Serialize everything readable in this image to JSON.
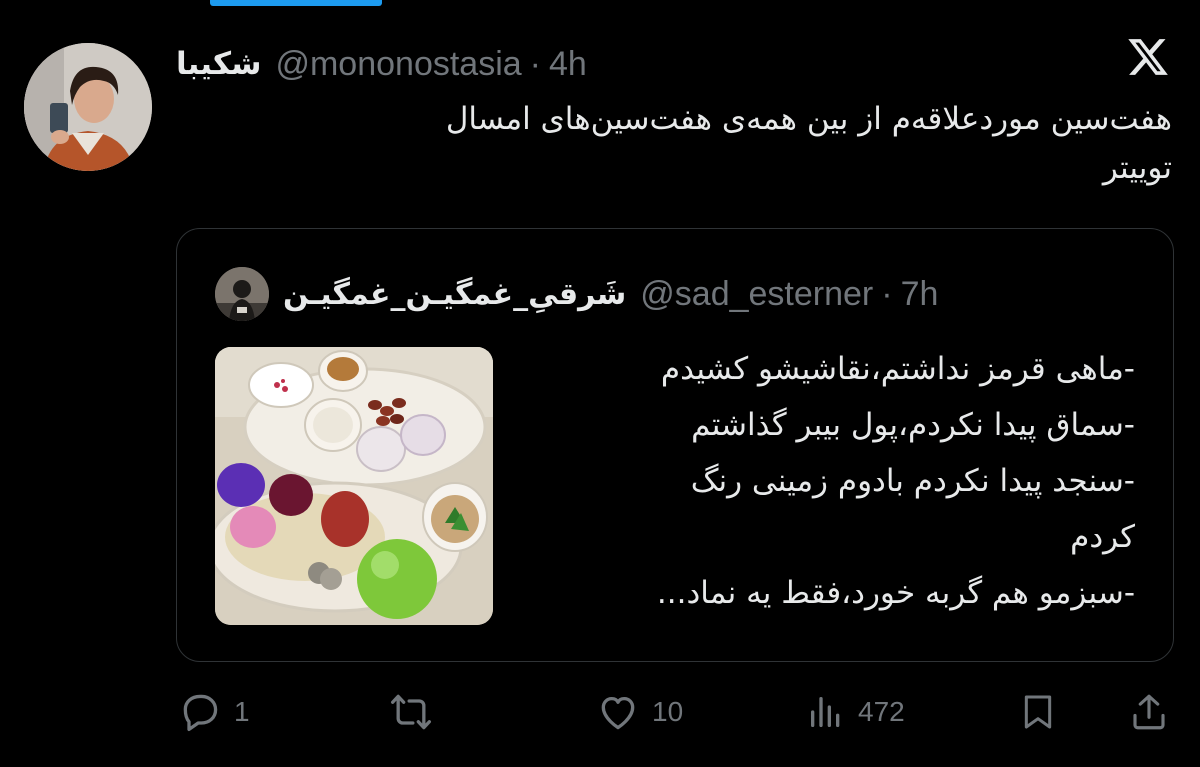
{
  "tweet": {
    "author": {
      "display_name": "شکیبا",
      "handle": "@mononostasia",
      "time": "4h"
    },
    "text": "هفت‌سین موردعلاقه‌م از بین همه‌ی هفت‌سین‌های امسال\nتوییتر",
    "quoted": {
      "author": {
        "display_name": "شَرقیِ_غمگیـن_غمگیـن",
        "handle": "@sad_esterner",
        "time": "7h"
      },
      "lines": [
        "-ماهی قرمز نداشتم،نقاشیشو کشیدم",
        "-سماق پیدا نکردم،پول بیبر گذاشتم",
        "-سنجد پیدا نکردم بادوم زمینی رنگ",
        "کردم",
        "-سبزمو هم گربه خورد،فقط یه نماد..."
      ]
    },
    "actions": {
      "replies": "1",
      "likes": "10",
      "views": "472"
    }
  },
  "icons": [
    "x-logo-icon",
    "reply-icon",
    "retweet-icon",
    "like-icon",
    "views-icon",
    "bookmark-icon",
    "share-icon"
  ],
  "colors": {
    "background": "#000000",
    "text": "#e7e9ea",
    "secondary": "#71767b",
    "border": "#2f3336",
    "accent": "#1d9bf0"
  }
}
